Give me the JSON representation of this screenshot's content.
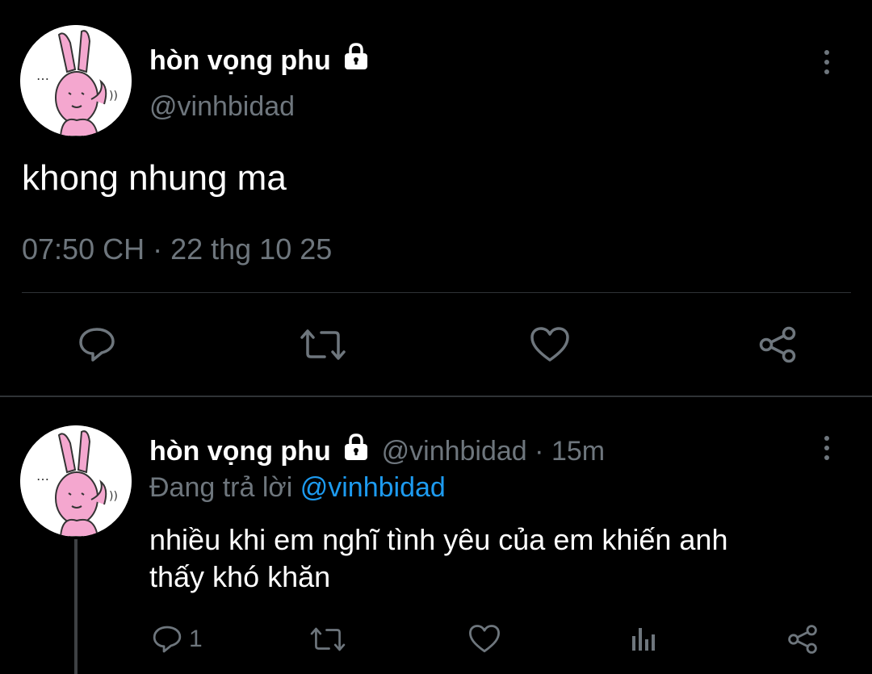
{
  "main_tweet": {
    "display_name": "hòn vọng phu",
    "handle": "@vinhbidad",
    "text": "khong nhung ma",
    "timestamp": "07:50 CH · 22 thg 10 25",
    "icons": {
      "avatar": "pink-rabbit-avatar",
      "locked": "lock-icon",
      "more": "more-vertical-icon",
      "reply": "reply-icon",
      "retweet": "retweet-icon",
      "like": "heart-icon",
      "share": "share-icon"
    }
  },
  "reply_tweet": {
    "display_name": "hòn vọng phu",
    "handle": "@vinhbidad",
    "separator": "·",
    "time_ago": "15m",
    "replying_prefix": "Đang trả lời",
    "replying_to": "@vinhbidad",
    "text_line1": "nhiều khi em nghĩ tình yêu của em khiến anh",
    "text_line2": "thấy khó khăn",
    "reply_count": "1",
    "icons": {
      "avatar": "pink-rabbit-avatar",
      "locked": "lock-icon",
      "more": "more-vertical-icon",
      "reply": "reply-icon",
      "retweet": "retweet-icon",
      "like": "heart-icon",
      "analytics": "analytics-icon",
      "share": "share-icon"
    }
  },
  "colors": {
    "background": "#000000",
    "text": "#e7e9ea",
    "secondary": "#6e767d",
    "link": "#1d9bf0",
    "avatar_pink": "#f4a7cf"
  }
}
